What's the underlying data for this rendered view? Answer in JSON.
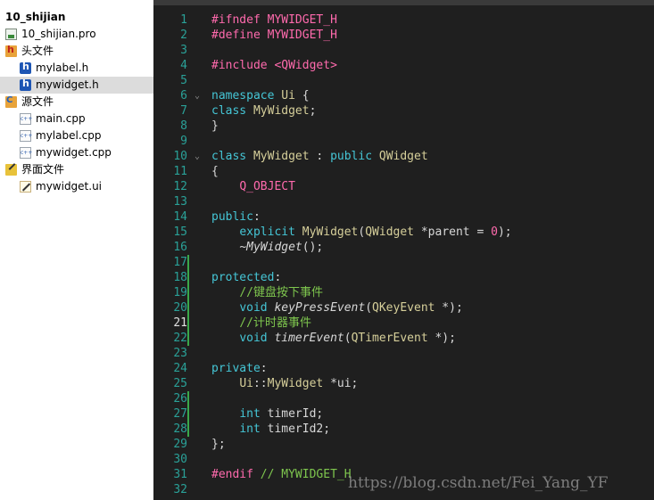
{
  "project": {
    "items": [
      {
        "label": "10_shijian",
        "icon": "project-root",
        "kind": "root"
      },
      {
        "label": "10_shijian.pro",
        "icon": "pro-file-icon",
        "kind": "file"
      },
      {
        "label": "头文件",
        "icon": "headers-folder-icon",
        "kind": "folder"
      },
      {
        "label": "mylabel.h",
        "icon": "header-file-icon",
        "kind": "file"
      },
      {
        "label": "mywidget.h",
        "icon": "header-file-icon",
        "kind": "file",
        "selected": true
      },
      {
        "label": "源文件",
        "icon": "sources-folder-icon",
        "kind": "folder"
      },
      {
        "label": "main.cpp",
        "icon": "cpp-file-icon",
        "kind": "file"
      },
      {
        "label": "mylabel.cpp",
        "icon": "cpp-file-icon",
        "kind": "file"
      },
      {
        "label": "mywidget.cpp",
        "icon": "cpp-file-icon",
        "kind": "file"
      },
      {
        "label": "界面文件",
        "icon": "forms-folder-icon",
        "kind": "folder"
      },
      {
        "label": "mywidget.ui",
        "icon": "ui-file-icon",
        "kind": "file"
      }
    ]
  },
  "editor": {
    "current_line": 21,
    "lines": [
      {
        "n": "1",
        "text": "#ifndef MYWIDGET_H"
      },
      {
        "n": "2",
        "text": "#define MYWIDGET_H"
      },
      {
        "n": "3",
        "text": ""
      },
      {
        "n": "4",
        "text": "#include <QWidget>"
      },
      {
        "n": "5",
        "text": ""
      },
      {
        "n": "6",
        "text": "namespace Ui {",
        "fold": true
      },
      {
        "n": "7",
        "text": "class MyWidget;"
      },
      {
        "n": "8",
        "text": "}"
      },
      {
        "n": "9",
        "text": ""
      },
      {
        "n": "10",
        "text": "class MyWidget : public QWidget",
        "fold": true
      },
      {
        "n": "11",
        "text": "{"
      },
      {
        "n": "12",
        "text": "    Q_OBJECT"
      },
      {
        "n": "13",
        "text": ""
      },
      {
        "n": "14",
        "text": "public:"
      },
      {
        "n": "15",
        "text": "    explicit MyWidget(QWidget *parent = 0);"
      },
      {
        "n": "16",
        "text": "    ~MyWidget();"
      },
      {
        "n": "17",
        "text": "",
        "changed": true
      },
      {
        "n": "18",
        "text": "protected:",
        "changed": true
      },
      {
        "n": "19",
        "text": "    //键盘按下事件",
        "changed": true
      },
      {
        "n": "20",
        "text": "    void keyPressEvent(QKeyEvent *);",
        "changed": true
      },
      {
        "n": "21",
        "text": "    //计时器事件",
        "changed": true
      },
      {
        "n": "22",
        "text": "    void timerEvent(QTimerEvent *);",
        "changed": true
      },
      {
        "n": "23",
        "text": ""
      },
      {
        "n": "24",
        "text": "private:"
      },
      {
        "n": "25",
        "text": "    Ui::MyWidget *ui;"
      },
      {
        "n": "26",
        "text": "",
        "changed": true
      },
      {
        "n": "27",
        "text": "    int timerId;",
        "changed": true
      },
      {
        "n": "28",
        "text": "    int timerId2;",
        "changed": true
      },
      {
        "n": "29",
        "text": "};"
      },
      {
        "n": "30",
        "text": ""
      },
      {
        "n": "31",
        "text": "#endif // MYWIDGET_H"
      },
      {
        "n": "32",
        "text": ""
      }
    ]
  },
  "watermark": "https://blog.csdn.net/Fei_Yang_YF",
  "colors": {
    "background": "#1f1f1f",
    "line_number": "#2aa198",
    "preprocessor": "#ff6aad",
    "keyword": "#45c6d6",
    "class_name": "#d6cf9a",
    "comment": "#7ec64e",
    "change_marker": "#3aa84a"
  }
}
